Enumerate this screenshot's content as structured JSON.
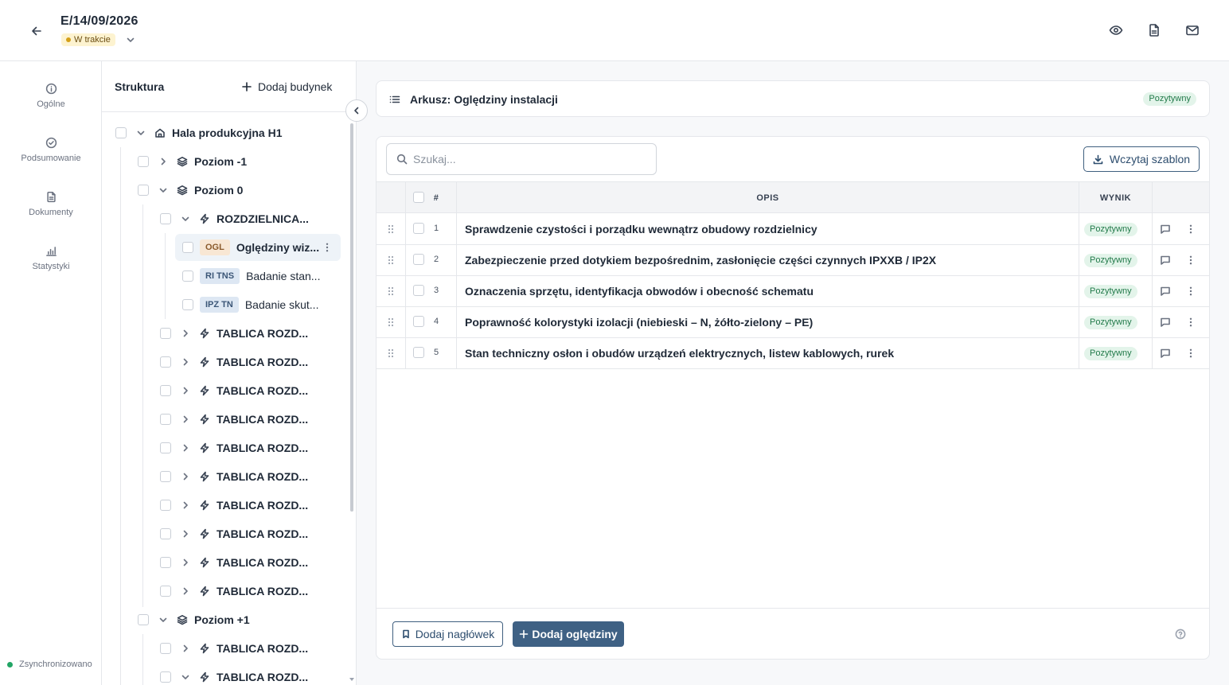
{
  "header": {
    "title": "E/14/09/2026",
    "status": "W trakcie"
  },
  "nav": {
    "items": [
      {
        "label": "Ogólne",
        "icon": "info-icon"
      },
      {
        "label": "Podsumowanie",
        "icon": "check-circle-icon"
      },
      {
        "label": "Dokumenty",
        "icon": "document-icon"
      },
      {
        "label": "Statystyki",
        "icon": "stats-icon"
      }
    ],
    "sync_status": "Zsynchronizowano"
  },
  "structure": {
    "title": "Struktura",
    "add_building": "Dodaj budynek",
    "building": "Hala produkcyjna H1",
    "levels": [
      "Poziom -1",
      "Poziom 0",
      "Poziom +1"
    ],
    "switchboard_open": "ROZDZIELNICA...",
    "sheets": [
      {
        "tag": "OGL",
        "label": "Oględziny wiz..."
      },
      {
        "tag": "RI TNS",
        "label": "Badanie stan..."
      },
      {
        "tag": "IPZ TN",
        "label": "Badanie skut..."
      }
    ],
    "board_label": "TABLICA ROZD..."
  },
  "sheet": {
    "title": "Arkusz: Oględziny instalacji",
    "result": "Pozytywny"
  },
  "toolbar": {
    "search_placeholder": "Szukaj...",
    "load_template": "Wczytaj szablon"
  },
  "table": {
    "headers": {
      "num": "#",
      "desc": "OPIS",
      "result": "WYNIK"
    },
    "rows": [
      {
        "num": "1",
        "desc": "Sprawdzenie czystości i porządku wewnątrz obudowy rozdzielnicy",
        "result": "Pozytywny"
      },
      {
        "num": "2",
        "desc": "Zabezpieczenie przed dotykiem bezpośrednim, zasłonięcie części czynnych IPXXB / IP2X",
        "result": "Pozytywny"
      },
      {
        "num": "3",
        "desc": "Oznaczenia sprzętu, identyfikacja obwodów i obecność schematu",
        "result": "Pozytywny"
      },
      {
        "num": "4",
        "desc": "Poprawność kolorystyki izolacji (niebieski – N, żółto-zielony – PE)",
        "result": "Pozytywny"
      },
      {
        "num": "5",
        "desc": "Stan techniczny osłon i obudów urządzeń elektrycznych, listew kablowych, rurek",
        "result": "Pozytywny"
      }
    ]
  },
  "footer": {
    "add_header": "Dodaj nagłówek",
    "add_inspection": "Dodaj oględziny"
  },
  "colors": {
    "primary": "#3f6184",
    "positive_bg": "#e3f4ea",
    "positive_text": "#227a4a",
    "status_bg": "#fdf3d0",
    "sync_dot": "#22a565"
  }
}
